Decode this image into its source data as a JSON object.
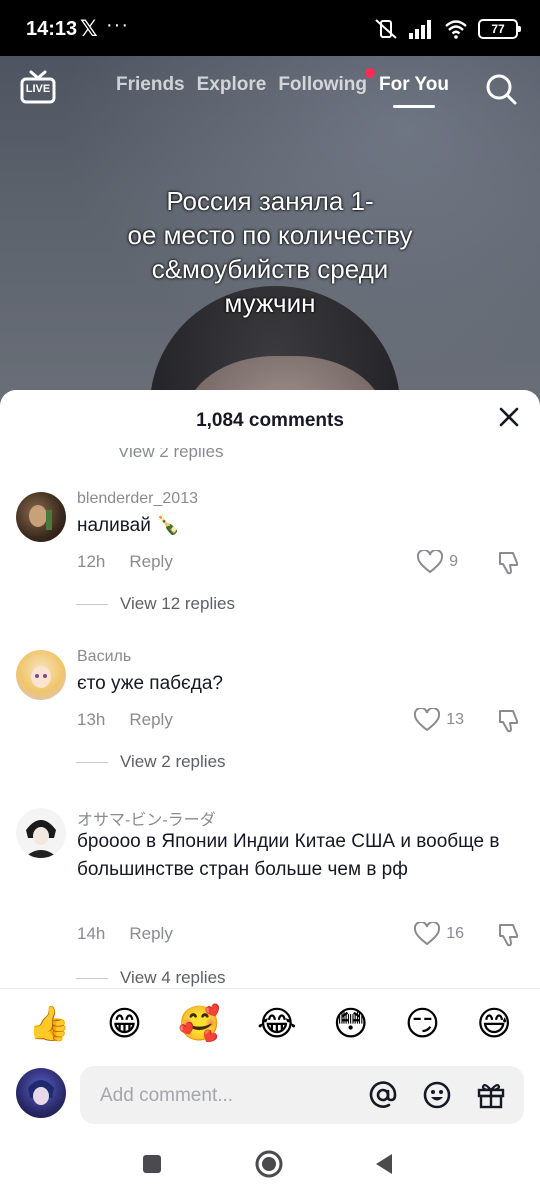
{
  "status_bar": {
    "time": "14:13",
    "x_logo": "𝕏",
    "dots": "···",
    "battery": "77"
  },
  "top_nav": {
    "live_label": "LIVE",
    "tabs": [
      {
        "label": "Friends"
      },
      {
        "label": "Explore"
      },
      {
        "label": "Following"
      },
      {
        "label": "For You"
      }
    ]
  },
  "video": {
    "overlay_lines": [
      "Россия заняла 1-",
      "ое место по количеству",
      "с&моубийств среди",
      "мужчин"
    ]
  },
  "comments_sheet": {
    "title": "1,084 comments",
    "partial_replies": "View 2 replies",
    "comments": [
      {
        "username": "blenderder_2013",
        "text": "наливай 🍾",
        "time": "12h",
        "reply_label": "Reply",
        "likes": "9",
        "view_replies": "View 12 replies"
      },
      {
        "username": "Василь",
        "text": "єто уже пабєда?",
        "time": "13h",
        "reply_label": "Reply",
        "likes": "13",
        "view_replies": "View 2 replies"
      },
      {
        "username": "オサマ-ビン-ラーダ",
        "text": "броооо в Японии Индии Китае США и вообще в большинстве стран больше чем в рф",
        "time": "14h",
        "reply_label": "Reply",
        "likes": "16",
        "view_replies": "View 4 replies"
      }
    ],
    "emojis": [
      "👍",
      "😁",
      "🥰",
      "😂",
      "😳",
      "😏",
      "😅"
    ],
    "input_placeholder": "Add comment..."
  }
}
